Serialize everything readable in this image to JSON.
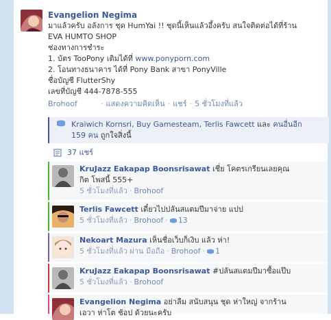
{
  "post": {
    "author": "Evangelion Negima",
    "lines": [
      "มาแล้วครับ อลังการ ชุด HumYai !! ชุดนี้เห็นแล้วอึ้งครับ สนใจติดต่อได้ที่ร้าน",
      "EVA HUMTO SHOP",
      "ช่องทางการชำระ",
      "1. บัตร TooPony เติมได้ที่ ",
      "2. โอนทางธนาคาร ได้ที่ Pony Bank สาขา PonyVille",
      "ชื่อบัญชี FlutterShy",
      "เลขที่บัญชี 444-7878-555"
    ],
    "link": "www.ponyporn.com",
    "meta": {
      "brohoof": "Brohoof",
      "comment": "แสดงความคิดเห็น",
      "share": "แชร์",
      "time": "5 ชั่วโมงที่แล้ว"
    }
  },
  "likes": {
    "names": "Kraiwich Kornsri, Buy Gamesteam, Terlis Fawcett",
    "and_word": "และ",
    "others": "คนอื่นอีก",
    "count": "159 คน",
    "suffix": "ถูกใจสิ่งนี้"
  },
  "shares": {
    "label": "37 แชร์"
  },
  "comments": [
    {
      "name": "KruJazz Eakapap Boonsrisawat",
      "text": "เชี่ย โคตรเกรียนเลยคุณ",
      "text2": "กิต โพสนี้ 555+",
      "time": "5 ชั่วโมงที่แล้ว",
      "brohoof": "Brohoof",
      "likes": "",
      "via": ""
    },
    {
      "name": "Terlis Fawcett",
      "text": "เดี๋ยวไปปลันสแตมปีมาจ่าย แปป",
      "text2": "",
      "time": "5 ชั่วโมงที่แล้ว",
      "brohoof": "Brohoof",
      "likes": "13",
      "via": ""
    },
    {
      "name": "Nekoart Mazura",
      "text": "เห็นชื่อเว็บก็เงิบ แล้ว ห่า!",
      "text2": "",
      "time": "5 ชั่วโมงที่แล้ว ผ่าน มือถือ",
      "brohoof": "Brohoof",
      "likes": "1",
      "via": ""
    },
    {
      "name": "KruJazz Eakapap Boonsrisawat",
      "text": "#ปลันสแตมปีมาซื้อแป๊บ",
      "text2": "",
      "time": "5 ชั่วโมงที่แล้ว",
      "brohoof": "Brohoof",
      "likes": "",
      "via": ""
    },
    {
      "name": "Evangelion Negima",
      "text": "อย่าลืม สนับสนุน ชุด ห่าใหญ่ จากร้าน",
      "text2": "เอวา ห่าโต ช้อป ด้วยนะครับ",
      "time": "",
      "brohoof": "",
      "likes": "",
      "via": ""
    }
  ],
  "colors": {
    "link": "#3b5998",
    "bar_green": "#42b72a",
    "bar_purple": "#7b5aa6",
    "bar_red": "#c0392b",
    "bar_pink": "#e0457b",
    "sidebar": "#d3e2f1"
  },
  "icons": {
    "like": "thumbs-up-icon",
    "share": "share-icon"
  }
}
